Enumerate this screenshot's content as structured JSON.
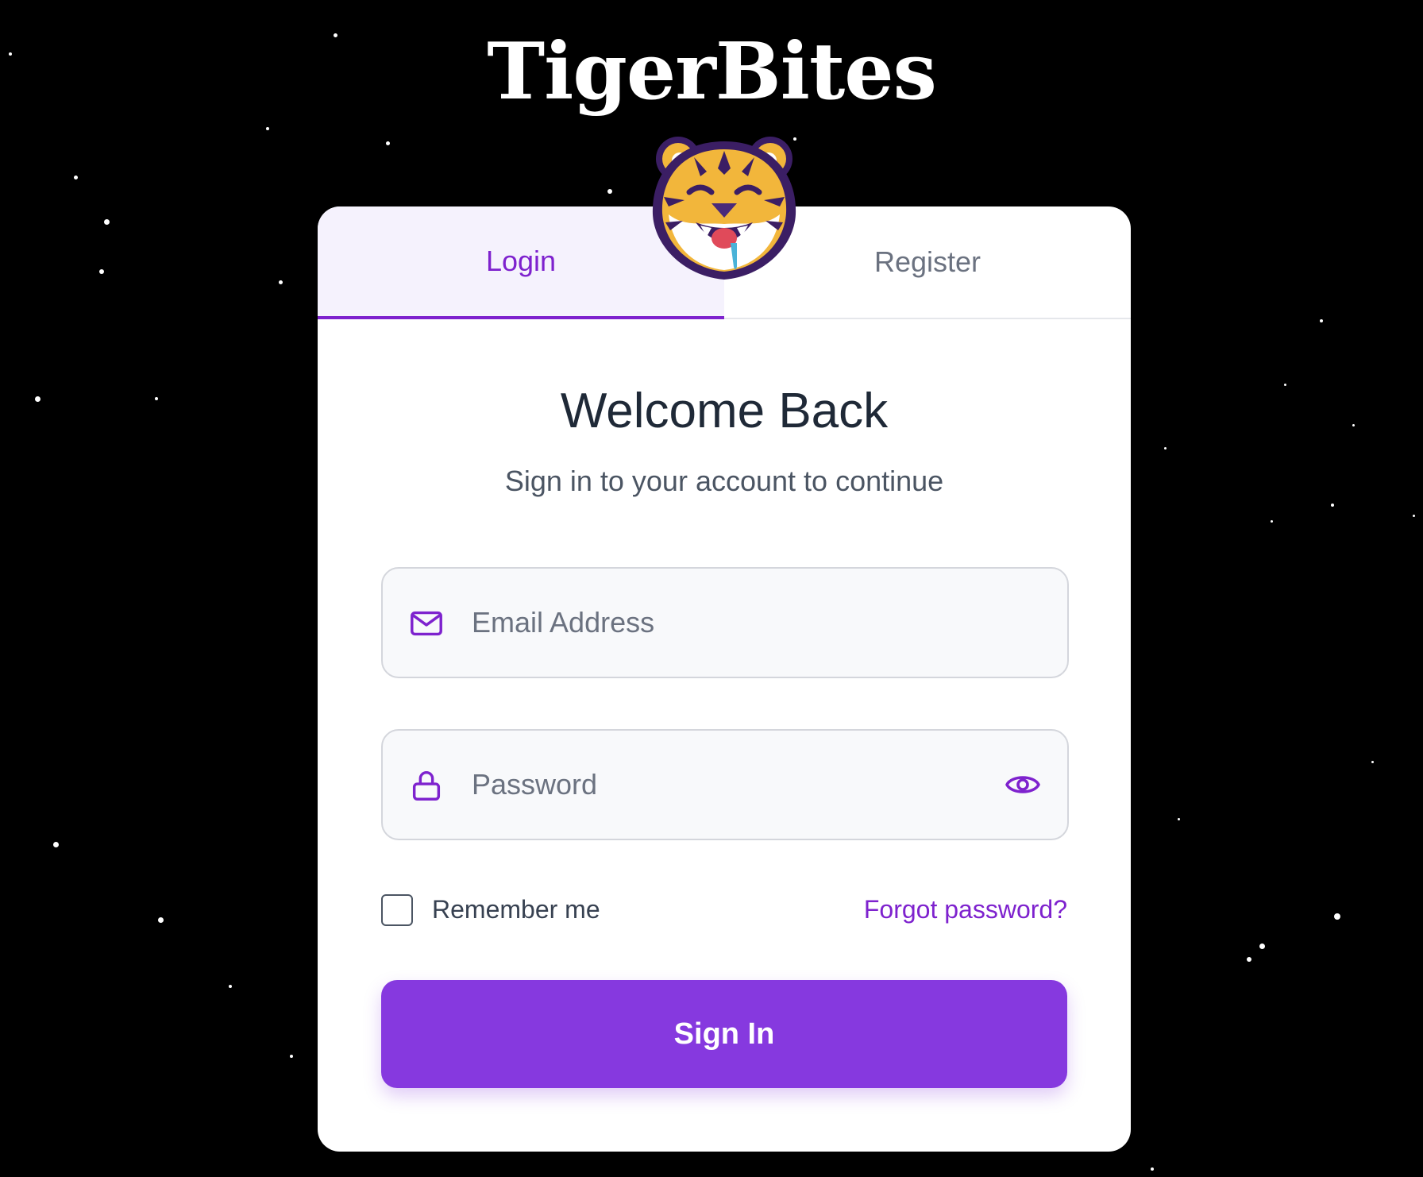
{
  "brand": {
    "title": "TigerBites",
    "mascot_icon": "tiger-mascot-icon"
  },
  "tabs": [
    {
      "label": "Login",
      "active": true
    },
    {
      "label": "Register",
      "active": false
    }
  ],
  "form": {
    "heading": "Welcome Back",
    "subtitle": "Sign in to your account to continue",
    "email": {
      "placeholder": "Email Address",
      "value": "",
      "icon": "mail-icon"
    },
    "password": {
      "placeholder": "Password",
      "value": "",
      "icon": "lock-icon",
      "toggle_icon": "eye-icon"
    },
    "remember_label": "Remember me",
    "remember_checked": false,
    "forgot_label": "Forgot password?",
    "submit_label": "Sign In"
  },
  "colors": {
    "background": "#000000",
    "accent": "#8639df",
    "accent_text": "#7e22ce",
    "card": "#ffffff"
  }
}
